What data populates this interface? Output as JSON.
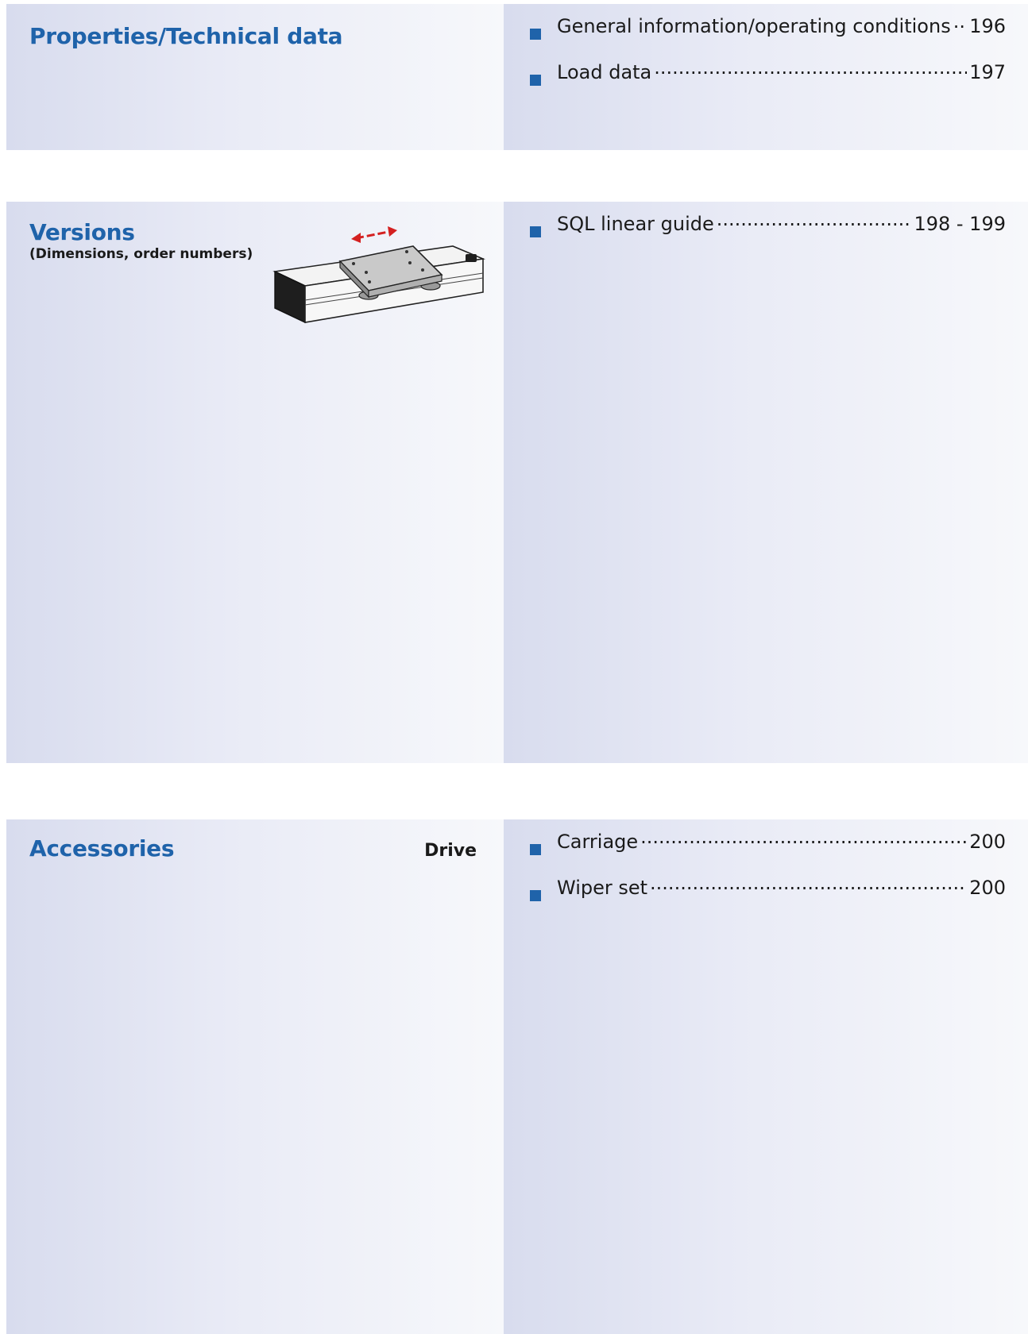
{
  "sections": {
    "properties": {
      "title": "Properties/Technical data",
      "items": [
        {
          "label": "General information/operating conditions",
          "page": "196"
        },
        {
          "label": "Load data",
          "page": "197"
        }
      ]
    },
    "versions": {
      "title": "Versions",
      "subtitle": "(Dimensions, order numbers)",
      "items": [
        {
          "label": "SQL linear guide",
          "page": "198 - 199"
        }
      ]
    },
    "accessories": {
      "title": "Accessories",
      "side_label": "Drive",
      "items": [
        {
          "label": "Carriage",
          "page": "200"
        },
        {
          "label": "Wiper set",
          "page": "200"
        }
      ]
    }
  },
  "colors": {
    "heading_blue": "#1f63aa",
    "bullet_blue": "#1f63aa",
    "arrow_red": "#d42020"
  },
  "icons": {
    "linear_guide": "linear-guide-illustration",
    "motion_arrow": "double-headed-arrow-icon"
  }
}
